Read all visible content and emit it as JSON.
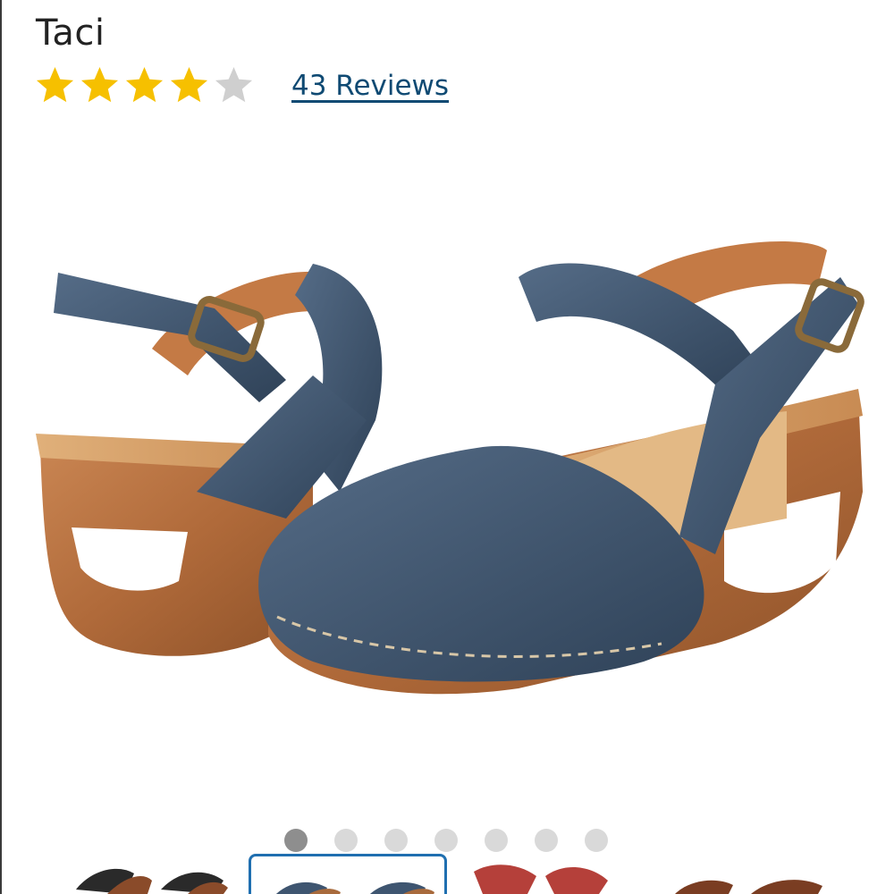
{
  "product": {
    "title": "Taci",
    "rating": 4,
    "rating_max": 5,
    "reviews_label": "43 Reviews"
  },
  "colors": {
    "star_filled": "#f6c000",
    "star_empty": "#cfcfcf",
    "link": "#0f4a73",
    "leather": "#3e5570",
    "wood": "#b87545",
    "footbed": "#d9a36a",
    "dot_active": "#8e8e8e",
    "dot_inactive": "#d9d9d9",
    "thumb_selected_border": "#1f6fb0"
  },
  "gallery": {
    "image_count": 7,
    "active_index": 0,
    "thumbnails": [
      {
        "variant": "black-brown",
        "selected": false
      },
      {
        "variant": "navy",
        "selected": true
      },
      {
        "variant": "red",
        "selected": false
      },
      {
        "variant": "brown",
        "selected": false
      }
    ]
  }
}
